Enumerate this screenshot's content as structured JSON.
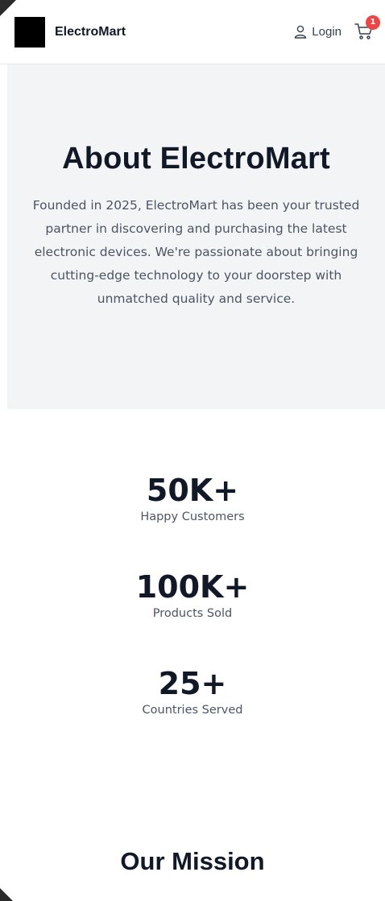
{
  "header": {
    "brand_name": "ElectroMart",
    "login_label": "Login",
    "cart_count": "1",
    "icons": {
      "logo": "logo-square",
      "user": "user-icon",
      "cart": "cart-icon"
    }
  },
  "hero": {
    "title": "About ElectroMart",
    "text": "Founded in 2025, ElectroMart has been your trusted partner in discovering and purchasing the latest electronic devices. We're passionate about bringing cutting-edge technology to your doorstep with unmatched quality and service."
  },
  "stats": [
    {
      "value": "50K+",
      "label": "Happy Customers"
    },
    {
      "value": "100K+",
      "label": "Products Sold"
    },
    {
      "value": "25+",
      "label": "Countries Served"
    }
  ],
  "mission": {
    "title": "Our Mission"
  },
  "colors": {
    "badge": "#ef4444",
    "hero_bg": "#f3f4f6",
    "text_primary": "#111827",
    "text_secondary": "#4b5563"
  }
}
